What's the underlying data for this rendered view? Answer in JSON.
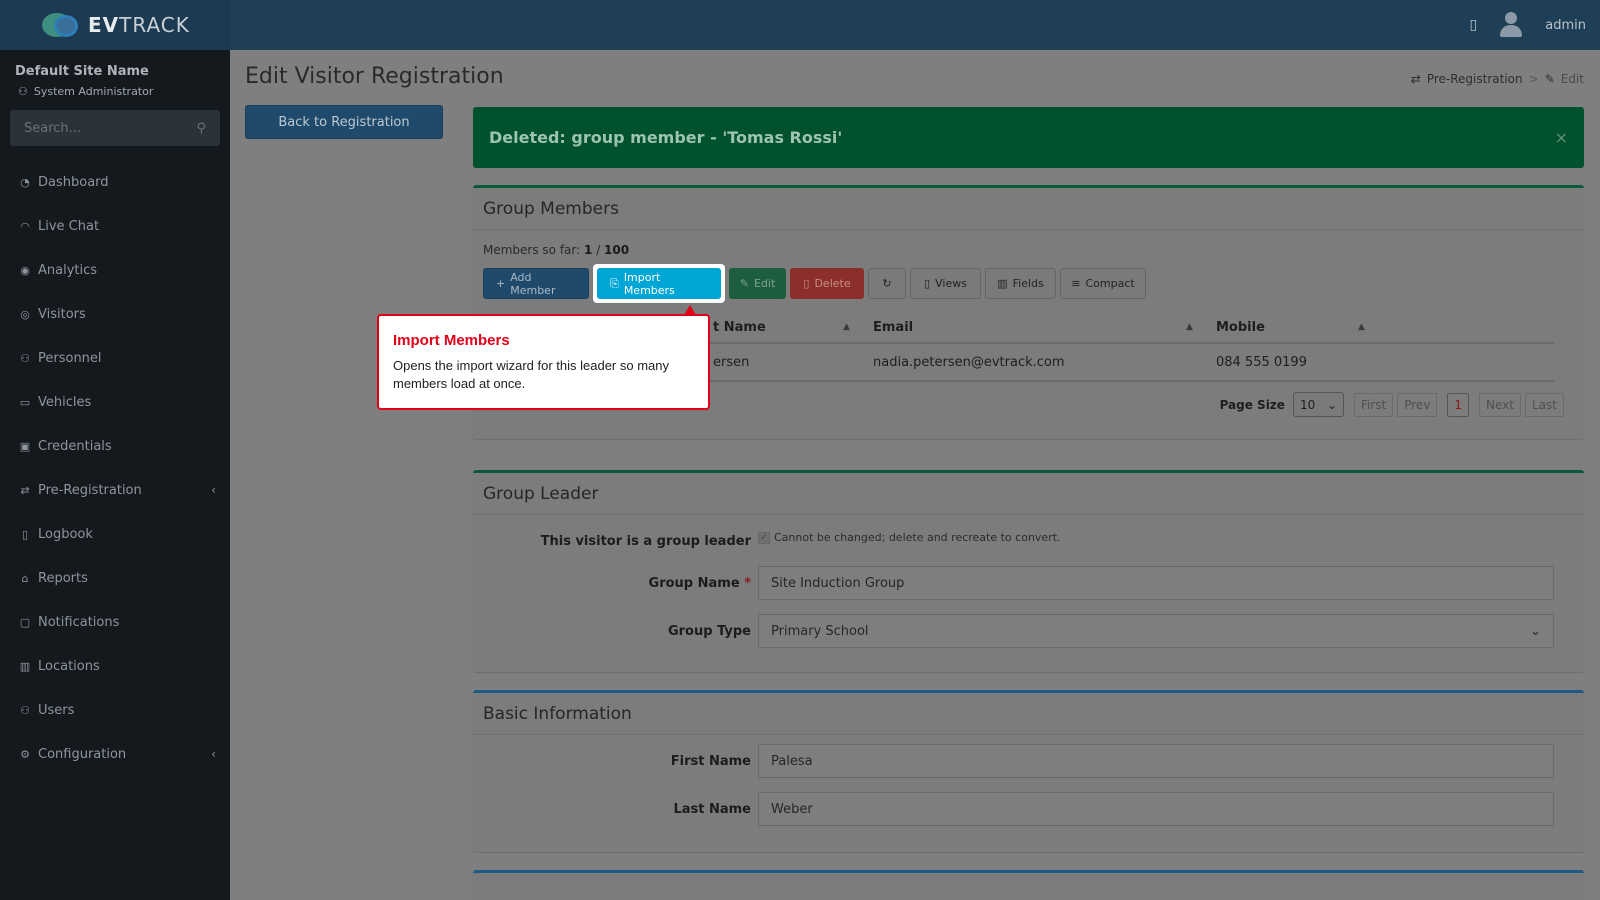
{
  "app": {
    "logo_prefix": "EV",
    "logo_suffix": "TRACK",
    "user": "admin"
  },
  "sidebar": {
    "site_name": "Default Site Name",
    "role": "System Administrator",
    "search_placeholder": "Search...",
    "items": [
      {
        "label": "Dashboard",
        "icon": "dashboard-icon"
      },
      {
        "label": "Live Chat",
        "icon": "headset-icon"
      },
      {
        "label": "Analytics",
        "icon": "target-icon"
      },
      {
        "label": "Visitors",
        "icon": "eye-icon"
      },
      {
        "label": "Personnel",
        "icon": "users-icon"
      },
      {
        "label": "Vehicles",
        "icon": "car-icon"
      },
      {
        "label": "Credentials",
        "icon": "id-card-icon"
      },
      {
        "label": "Pre-Registration",
        "icon": "arrows-icon",
        "chevron": "‹"
      },
      {
        "label": "Logbook",
        "icon": "book-icon"
      },
      {
        "label": "Reports",
        "icon": "chart-icon"
      },
      {
        "label": "Notifications",
        "icon": "chat-icon"
      },
      {
        "label": "Locations",
        "icon": "map-icon"
      },
      {
        "label": "Users",
        "icon": "user-group-icon"
      },
      {
        "label": "Configuration",
        "icon": "gear-icon",
        "chevron": "‹"
      }
    ]
  },
  "page": {
    "title": "Edit Visitor Registration",
    "breadcrumb": {
      "parent": "Pre-Registration",
      "current": "Edit"
    },
    "back_button": "Back to Registration"
  },
  "alert": {
    "message": "Deleted: group member - 'Tomas Rossi'",
    "close": "×"
  },
  "group_members": {
    "title": "Group Members",
    "count_label": "Members so far:",
    "count_current": "1",
    "count_sep": " / ",
    "count_max": "100",
    "toolbar": {
      "add": "Add Member",
      "import": "Import Members",
      "edit": "Edit",
      "delete": "Delete",
      "views": "Views",
      "fields": "Fields",
      "compact": "Compact"
    },
    "columns": [
      "t Name",
      "Email",
      "Mobile"
    ],
    "rows": [
      {
        "name": "ersen",
        "email": "nadia.petersen@evtrack.com",
        "mobile": "084 555 0199"
      }
    ],
    "pager": {
      "page_size_label": "Page Size",
      "page_size": "10",
      "first": "First",
      "prev": "Prev",
      "current": "1",
      "next": "Next",
      "last": "Last"
    }
  },
  "group_leader": {
    "title": "Group Leader",
    "leader_label": "This visitor is a group leader",
    "leader_note": "Cannot be changed; delete and recreate to convert.",
    "name_label": "Group Name",
    "name_value": "Site Induction Group",
    "type_label": "Group Type",
    "type_value": "Primary School"
  },
  "basic_info": {
    "title": "Basic Information",
    "first_name_label": "First Name",
    "first_name_value": "Palesa",
    "last_name_label": "Last Name",
    "last_name_value": "Weber"
  },
  "callout": {
    "title": "Import Members",
    "body": "Opens the import wizard for this leader so many members load at once."
  }
}
